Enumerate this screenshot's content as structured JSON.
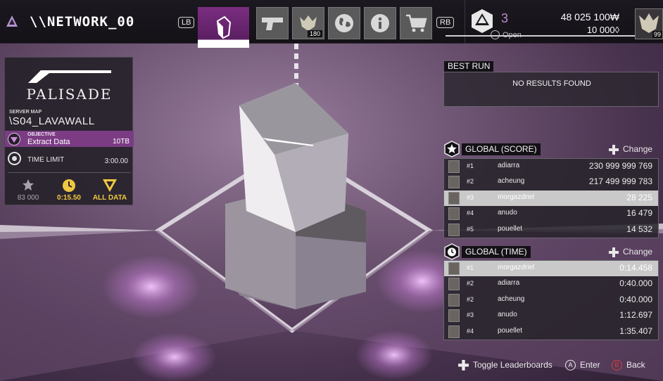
{
  "header": {
    "title": "\\\\NETWORK_00",
    "lb": "LB",
    "rb": "RB",
    "tabs": [
      {
        "icon": "crystal-icon",
        "active": true
      },
      {
        "icon": "pistol-icon",
        "active": false
      },
      {
        "icon": "avatar-icon",
        "active": false,
        "count": "180"
      },
      {
        "icon": "globe-icon",
        "active": false
      },
      {
        "icon": "info-icon",
        "active": false
      },
      {
        "icon": "cart-icon",
        "active": false
      }
    ],
    "rank_level": "3",
    "rank_status": "Open",
    "credits_primary": "48 025 100₩",
    "credits_secondary": "10 000◊",
    "avatar_badge": "99"
  },
  "map_card": {
    "logo": "PALISADE",
    "server_label": "SERVER MAP",
    "server_name": "\\S04_LAVAWALL",
    "objective_label": "OBJECTIVE",
    "objective_value": "Extract Data",
    "objective_size": "10TB",
    "time_limit_label": "TIME LIMIT",
    "time_limit_value": "3:00.00",
    "medals": [
      {
        "icon": "star-icon",
        "value": "83 000",
        "color": "#a8a4ac"
      },
      {
        "icon": "stopwatch-icon",
        "value": "0:15.50",
        "color": "#f0c840"
      },
      {
        "icon": "data-triangle-icon",
        "value": "ALL DATA",
        "color": "#f0c840"
      }
    ]
  },
  "best_run": {
    "title": "BEST RUN",
    "empty_text": "NO RESULTS FOUND"
  },
  "leaderboard_score": {
    "title": "GLOBAL (SCORE)",
    "change_label": "Change",
    "rows": [
      {
        "rank": "#1",
        "name": "adiarra",
        "value": "230 999 999 769",
        "highlight": false
      },
      {
        "rank": "#2",
        "name": "acheung",
        "value": "217 499 999 783",
        "highlight": false
      },
      {
        "rank": "#3",
        "name": "morgazdriel",
        "value": "28 225",
        "highlight": true
      },
      {
        "rank": "#4",
        "name": "anudo",
        "value": "16 479",
        "highlight": false
      },
      {
        "rank": "#5",
        "name": "pouellet",
        "value": "14 532",
        "highlight": false
      }
    ]
  },
  "leaderboard_time": {
    "title": "GLOBAL (TIME)",
    "change_label": "Change",
    "rows": [
      {
        "rank": "#1",
        "name": "morgazdriel",
        "value": "0:14.458",
        "highlight": true
      },
      {
        "rank": "#2",
        "name": "adiarra",
        "value": "0:40.000",
        "highlight": false
      },
      {
        "rank": "#2",
        "name": "acheung",
        "value": "0:40.000",
        "highlight": false
      },
      {
        "rank": "#3",
        "name": "anudo",
        "value": "1:12.697",
        "highlight": false
      },
      {
        "rank": "#4",
        "name": "pouellet",
        "value": "1:35.407",
        "highlight": false
      }
    ]
  },
  "hints": {
    "toggle": "Toggle Leaderboards",
    "enter_button": "A",
    "enter": "Enter",
    "back_button": "B",
    "back": "Back"
  },
  "colors": {
    "accent": "#7b3c84",
    "gold": "#f0c840",
    "highlight_row": "#c9c9c9"
  }
}
